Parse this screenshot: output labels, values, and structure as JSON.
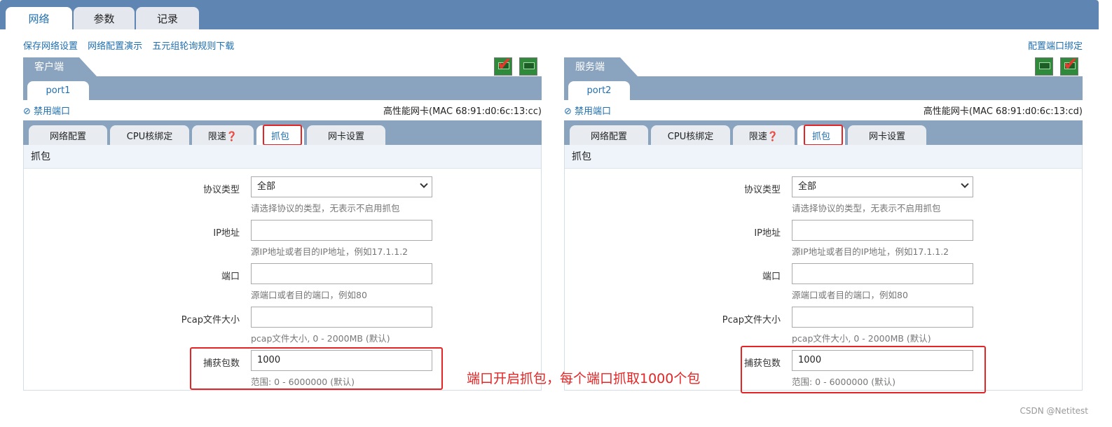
{
  "main_tabs": [
    {
      "label": "网络"
    },
    {
      "label": "参数"
    },
    {
      "label": "记录"
    }
  ],
  "links": {
    "save": "保存网络设置",
    "demo": "网络配置演示",
    "download": "五元组轮询规则下载",
    "bind": "配置端口绑定"
  },
  "client": {
    "title": "客户端",
    "port": "port1",
    "disable": "禁用端口",
    "nic": "高性能网卡(MAC 68:91:d0:6c:13:cc)",
    "subtabs": [
      {
        "label": "网络配置"
      },
      {
        "label": "CPU核绑定"
      },
      {
        "label": "限速❓"
      },
      {
        "label": "抓包"
      },
      {
        "label": "网卡设置"
      }
    ]
  },
  "server": {
    "title": "服务端",
    "port": "port2",
    "disable": "禁用端口",
    "nic": "高性能网卡(MAC 68:91:d0:6c:13:cd)",
    "subtabs": [
      {
        "label": "网络配置"
      },
      {
        "label": "CPU核绑定"
      },
      {
        "label": "限速❓"
      },
      {
        "label": "抓包"
      },
      {
        "label": "网卡设置"
      }
    ]
  },
  "capture": {
    "section": "抓包",
    "protocol": {
      "label": "协议类型",
      "value": "全部",
      "hint": "请选择协议的类型，无表示不启用抓包"
    },
    "ip": {
      "label": "IP地址",
      "value": "",
      "hint": "源IP地址或者目的IP地址，例如17.1.1.2"
    },
    "port": {
      "label": "端口",
      "value": "",
      "hint": "源端口或者目的端口，例如80"
    },
    "pcap": {
      "label": "Pcap文件大小",
      "value": "",
      "hint": "pcap文件大小, 0 - 2000MB (默认)"
    },
    "count": {
      "label": "捕获包数",
      "value": "1000",
      "hint": "范围: 0 - 6000000 (默认)"
    }
  },
  "annotation": "端口开启抓包，每个端口抓取1000个包",
  "watermark": "CSDN @Netitest",
  "colors": {
    "header_blue": "#5f86b3",
    "panel_blue": "#8aa3bf",
    "link": "#1f6fb2",
    "highlight_red": "#e52525"
  }
}
